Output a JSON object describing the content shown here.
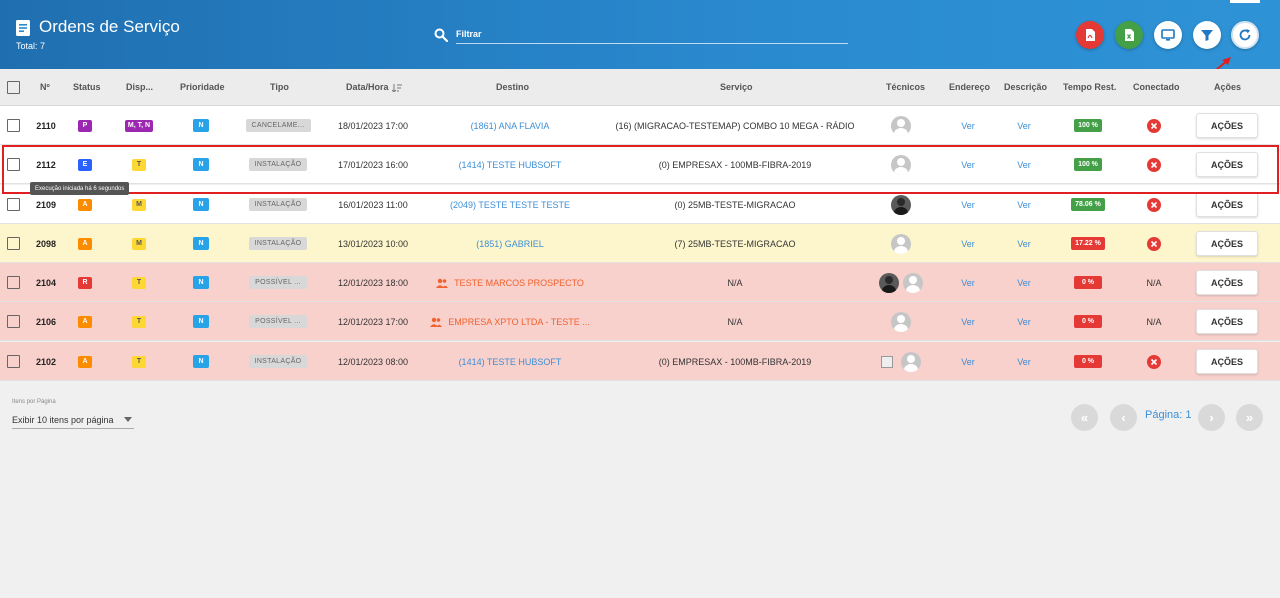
{
  "header": {
    "title": "Ordens de Serviço",
    "total": "Total: 7",
    "filter_placeholder": "Filtrar"
  },
  "columns": {
    "num": "Nº",
    "status": "Status",
    "disp": "Disp...",
    "prioridade": "Prioridade",
    "tipo": "Tipo",
    "datahora": "Data/Hora",
    "destino": "Destino",
    "servico": "Serviço",
    "tecnicos": "Técnicos",
    "endereco": "Endereço",
    "descricao": "Descrição",
    "tempo": "Tempo Rest.",
    "conectado": "Conectado",
    "acoes": "Ações"
  },
  "rows": [
    {
      "num": "2110",
      "status": "P",
      "status_color": "#9c27b0",
      "disp": "M, T, N",
      "disp_color": "#9c27b0",
      "prioridade": "N",
      "tipo": "CANCELAME...",
      "datahora": "18/01/2023 17:00",
      "destino": "(1861) ANA FLAVIA",
      "servico": "(16) (MIGRACAO-TESTEMAP) COMBO 10 MEGA - RÁDIO",
      "endereco": "Ver",
      "descricao": "Ver",
      "tempo": "100 %",
      "tempo_color": "#43a047",
      "conectado": "x",
      "acoes": "AÇÕES"
    },
    {
      "num": "2112",
      "status": "E",
      "status_color": "#2962ff",
      "disp": "T",
      "disp_color": "#fdd835",
      "prioridade": "N",
      "tipo": "INSTALAÇÃO",
      "datahora": "17/01/2023 16:00",
      "destino": "(1414) TESTE HUBSOFT",
      "servico": "(0) EMPRESAX - 100MB-FIBRA-2019",
      "endereco": "Ver",
      "descricao": "Ver",
      "tempo": "100 %",
      "tempo_color": "#43a047",
      "conectado": "x",
      "acoes": "AÇÕES"
    },
    {
      "num": "2109",
      "status": "A",
      "status_color": "#fb8c00",
      "disp": "M",
      "disp_color": "#fdd835",
      "prioridade": "N",
      "tipo": "INSTALAÇÃO",
      "datahora": "16/01/2023 11:00",
      "destino": "(2049) TESTE TESTE TESTE",
      "servico": "(0) 25MB-TESTE-MIGRACAO",
      "endereco": "Ver",
      "descricao": "Ver",
      "tempo": "78.06 %",
      "tempo_color": "#43a047",
      "conectado": "x",
      "acoes": "AÇÕES"
    },
    {
      "num": "2098",
      "status": "A",
      "status_color": "#fb8c00",
      "disp": "M",
      "disp_color": "#fdd835",
      "prioridade": "N",
      "tipo": "INSTALAÇÃO",
      "datahora": "13/01/2023 10:00",
      "destino": "(1851) GABRIEL",
      "servico": "(7) 25MB-TESTE-MIGRACAO",
      "endereco": "Ver",
      "descricao": "Ver",
      "tempo": "17.22 %",
      "tempo_color": "#e53935",
      "conectado": "x",
      "acoes": "AÇÕES"
    },
    {
      "num": "2104",
      "status": "R",
      "status_color": "#e53935",
      "disp": "T",
      "disp_color": "#fdd835",
      "prioridade": "N",
      "tipo": "POSSÍVEL ...",
      "datahora": "12/01/2023 18:00",
      "destino": "TESTE MARCOS PROSPECTO",
      "servico": "N/A",
      "endereco": "Ver",
      "descricao": "Ver",
      "tempo": "0 %",
      "tempo_color": "#e53935",
      "conectado": "N/A",
      "acoes": "AÇÕES"
    },
    {
      "num": "2106",
      "status": "A",
      "status_color": "#fb8c00",
      "disp": "T",
      "disp_color": "#fdd835",
      "prioridade": "N",
      "tipo": "POSSÍVEL ...",
      "datahora": "12/01/2023 17:00",
      "destino": "EMPRESA XPTO LTDA - TESTE ...",
      "servico": "N/A",
      "endereco": "Ver",
      "descricao": "Ver",
      "tempo": "0 %",
      "tempo_color": "#e53935",
      "conectado": "N/A",
      "acoes": "AÇÕES"
    },
    {
      "num": "2102",
      "status": "A",
      "status_color": "#fb8c00",
      "disp": "T",
      "disp_color": "#fdd835",
      "prioridade": "N",
      "tipo": "INSTALAÇÃO",
      "datahora": "12/01/2023 08:00",
      "destino": "(1414) TESTE HUBSOFT",
      "servico": "(0) EMPRESAX - 100MB-FIBRA-2019",
      "endereco": "Ver",
      "descricao": "Ver",
      "tempo": "0 %",
      "tempo_color": "#e53935",
      "conectado": "x",
      "acoes": "AÇÕES"
    }
  ],
  "tooltip": "Execução iniciada há 6 segundos",
  "pagination": {
    "items_per_page_label": "Itens por Página",
    "items_per_page_value": "Exibir 10 itens por página",
    "page_label": "Página: 1"
  },
  "colors": {
    "header_blue": "#2a8ad0",
    "priority_blue": "#29a3e8",
    "link_blue": "#3d8fd6",
    "prospect_orange": "#f0622e",
    "highlight_red": "#e02020"
  }
}
